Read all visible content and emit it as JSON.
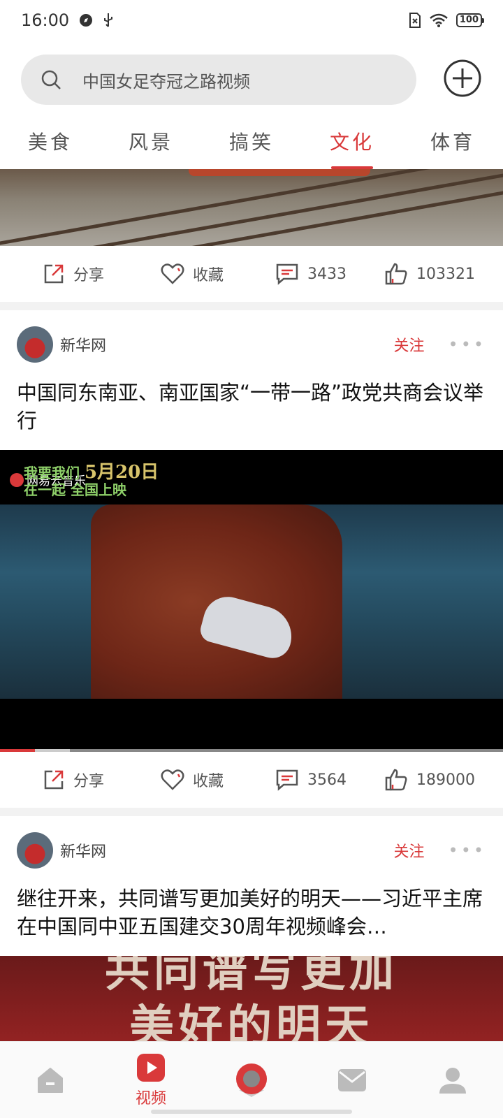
{
  "status_bar": {
    "time": "16:00",
    "battery": "100"
  },
  "search": {
    "placeholder": "中国女足夺冠之路视频"
  },
  "tabs": [
    {
      "label": "美食",
      "active": false
    },
    {
      "label": "风景",
      "active": false
    },
    {
      "label": "搞笑",
      "active": false
    },
    {
      "label": "文化",
      "active": true
    },
    {
      "label": "体育",
      "active": false
    }
  ],
  "posts": [
    {
      "actions": {
        "share": "分享",
        "favorite": "收藏",
        "comments": "3433",
        "likes": "103321"
      }
    },
    {
      "author": "新华网",
      "follow": "关注",
      "title": "中国同东南亚、南亚国家“一带一路”政党共商会议举行",
      "video": {
        "overlay_line1": "我要我们",
        "overlay_date": "5月20日",
        "overlay_line2": "在一起 全国上映",
        "brand": "网易云音乐",
        "progress": 0.07
      },
      "actions": {
        "share": "分享",
        "favorite": "收藏",
        "comments": "3564",
        "likes": "189000"
      }
    },
    {
      "author": "新华网",
      "follow": "关注",
      "title": "继往开来，共同谱写更加美好的明天——习近平主席在中国同中亚五国建交30周年视频峰会…",
      "image_text_line1": "共同谱写更加",
      "image_text_line2": "美好的明天"
    }
  ],
  "bottom_nav": {
    "items": [
      {
        "name": "home",
        "label": ""
      },
      {
        "name": "video",
        "label": "视频",
        "active": true
      },
      {
        "name": "music",
        "label": ""
      },
      {
        "name": "messages",
        "label": ""
      },
      {
        "name": "profile",
        "label": ""
      }
    ]
  },
  "colors": {
    "accent": "#d9393a"
  }
}
